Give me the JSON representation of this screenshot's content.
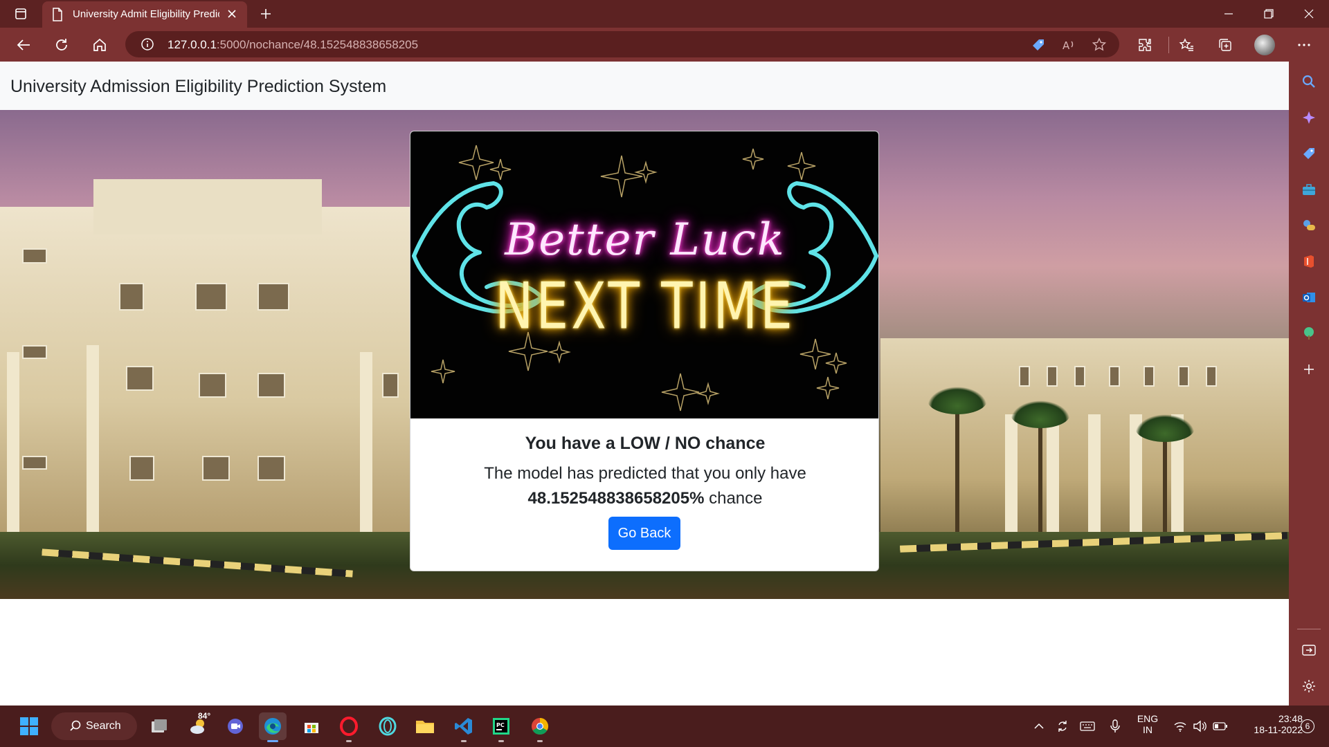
{
  "browser": {
    "tab_title": "University Admit Eligibility Predic",
    "url_host": "127.0.0.1",
    "url_rest": ":5000/nochance/48.152548838658205"
  },
  "page": {
    "navbar_brand": "University Admission Eligibility Prediction System",
    "card": {
      "image_text_line1": "Better Luck",
      "image_text_line2": "NEXT TIME",
      "title": "You have a LOW / NO chance",
      "text_line1": "The model has predicted that you only have",
      "chance_value": "48.152548838658205%",
      "chance_suffix": " chance",
      "button_label": "Go Back"
    }
  },
  "taskbar": {
    "search_label": "Search",
    "weather_temp": "84°",
    "lang_line1": "ENG",
    "lang_line2": "IN",
    "time": "23:48",
    "date": "18-11-2022",
    "notification_count": "6"
  },
  "colors": {
    "chrome": "#7c3232",
    "tabbar": "#5c2222",
    "taskbar": "#4a1d1d",
    "primary_button": "#0d6efd"
  }
}
